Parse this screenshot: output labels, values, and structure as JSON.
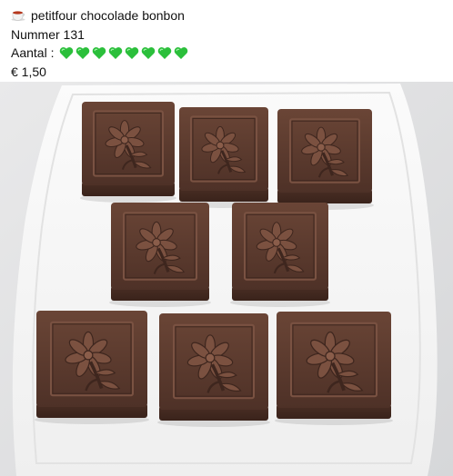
{
  "post": {
    "cup_icon": "coffee-cup-icon",
    "title": "petitfour chocolade bonbon",
    "number": "Nummer 131",
    "quantity_label": "Aantal :",
    "quantity_hearts": 8,
    "heart_icon": "green-heart-icon",
    "heart_color": "#2bbf3b",
    "price": "€ 1,50"
  },
  "photo": {
    "subject": "eight-square-chocolate-bonbons-with-flower-emboss-on-white-plate",
    "chocolate_color": "#5b3a2e",
    "plate_color": "#f3f3f3"
  }
}
